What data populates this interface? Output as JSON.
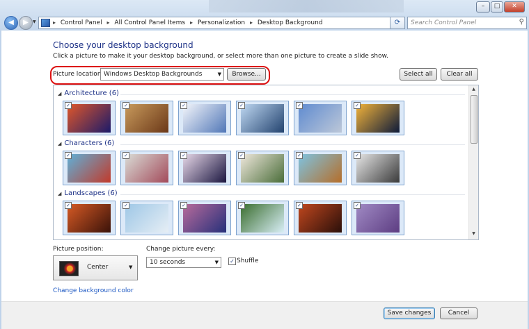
{
  "window": {
    "minimize": "–",
    "maximize": "□",
    "close": "✕"
  },
  "address": {
    "crumbs": [
      "Control Panel",
      "All Control Panel Items",
      "Personalization",
      "Desktop Background"
    ],
    "search_placeholder": "Search Control Panel"
  },
  "page": {
    "heading": "Choose your desktop background",
    "subtext": "Click a picture to make it your desktop background, or select more than one picture to create a slide show.",
    "location_label": "Picture location:",
    "location_value": "Windows Desktop Backgrounds",
    "browse": "Browse...",
    "select_all": "Select all",
    "clear_all": "Clear all"
  },
  "gallery": {
    "groups": [
      {
        "label": "Architecture (6)",
        "thumbs": [
          {
            "c1": "#e0572a",
            "c2": "#1b1a6a"
          },
          {
            "c1": "#c89a5c",
            "c2": "#6b3818"
          },
          {
            "c1": "#f4f6fb",
            "c2": "#5177b7"
          },
          {
            "c1": "#bfd8f2",
            "c2": "#23436f"
          },
          {
            "c1": "#5f8bd0",
            "c2": "#bcc7d8"
          },
          {
            "c1": "#f2b33a",
            "c2": "#0d1a3a"
          }
        ]
      },
      {
        "label": "Characters (6)",
        "thumbs": [
          {
            "c1": "#5fb0d8",
            "c2": "#c13a2b"
          },
          {
            "c1": "#d9dcd6",
            "c2": "#a34a5a"
          },
          {
            "c1": "#e7d8e8",
            "c2": "#1b1640"
          },
          {
            "c1": "#f0e8dd",
            "c2": "#4a6d39"
          },
          {
            "c1": "#7ec3e1",
            "c2": "#b56e2a"
          },
          {
            "c1": "#e6e6e6",
            "c2": "#3a3a3a"
          }
        ]
      },
      {
        "label": "Landscapes (6)",
        "thumbs": [
          {
            "c1": "#d65a25",
            "c2": "#3a1209"
          },
          {
            "c1": "#9ec7e6",
            "c2": "#e6eef5"
          },
          {
            "c1": "#b86b9c",
            "c2": "#26307a"
          },
          {
            "c1": "#3b6e2f",
            "c2": "#d8eef6"
          },
          {
            "c1": "#c0471e",
            "c2": "#2a0f0a"
          },
          {
            "c1": "#a08ac4",
            "c2": "#5d3d82"
          }
        ]
      }
    ]
  },
  "position": {
    "label": "Picture position:",
    "value": "Center"
  },
  "change": {
    "label": "Change picture every:",
    "value": "10 seconds"
  },
  "shuffle": {
    "label": "Shuffle",
    "checked": true
  },
  "bg_color_link": "Change background color",
  "footer": {
    "save": "Save changes",
    "cancel": "Cancel"
  }
}
